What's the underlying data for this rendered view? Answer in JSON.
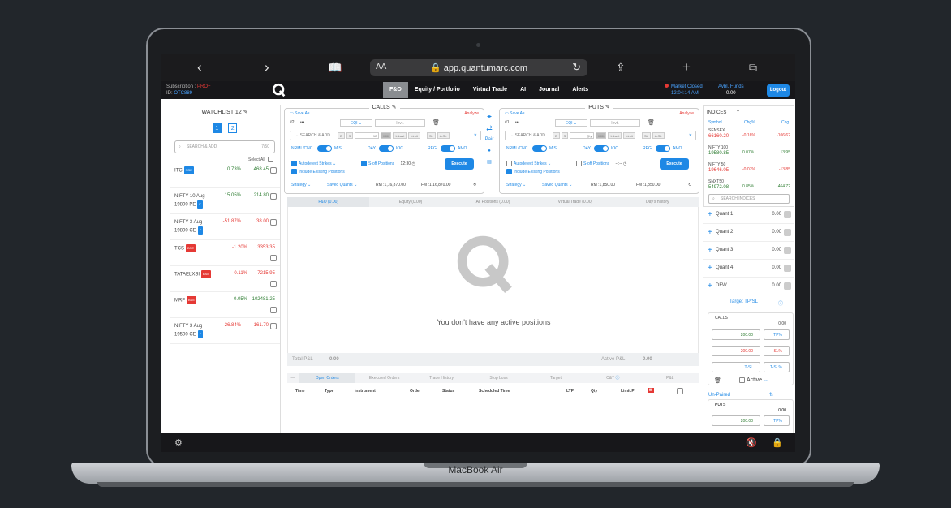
{
  "device": {
    "brand": "MacBook Air"
  },
  "browser": {
    "aa": "AA",
    "url": "app.quantumarc.com"
  },
  "header": {
    "subscription_label": "Subscription : ",
    "subscription_value": "PRO+",
    "id_label": "ID: ",
    "id_value": "OTC889",
    "nav": [
      "F&O",
      "Equity / Portfolio",
      "Virtual Trade",
      "AI",
      "Journal",
      "Alerts"
    ],
    "market_status": "Market Closed",
    "time": "12:04:14 AM",
    "funds_label": "Avbl. Funds",
    "funds_value": "0.00",
    "logout": "Logout"
  },
  "watchlist": {
    "title": "WATCHLIST 12",
    "tabs": [
      "1",
      "2"
    ],
    "search_placeholder": "SEARCH & ADD",
    "search_count": "7/50",
    "select_all": "Select All",
    "rows": [
      {
        "name1": "ITC",
        "name2": "",
        "tag": "NSE",
        "pct": "0.73%",
        "val": "468.45",
        "pos": true
      },
      {
        "name1": "NIFTY 10 Aug",
        "name2": "19800 PE",
        "tag": "F",
        "pct": "15.05%",
        "val": "214.80",
        "pos": true
      },
      {
        "name1": "NIFTY 3 Aug",
        "name2": "19800 CE",
        "tag": "F",
        "pct": "-51.87%",
        "val": "38.00",
        "pos": false
      },
      {
        "name1": "TCS",
        "name2": "",
        "tag": "BSE",
        "pct": "-1.20%",
        "val": "3353.35",
        "pos": false
      },
      {
        "name1": "TATAELXSI",
        "name2": "",
        "tag": "BSE",
        "pct": "-0.11%",
        "val": "7215.95",
        "pos": false
      },
      {
        "name1": "MRF",
        "name2": "",
        "tag": "BSE",
        "pct": "0.05%",
        "val": "102481.25",
        "pos": true
      },
      {
        "name1": "NIFTY 3 Aug",
        "name2": "19500 CE",
        "tag": "F",
        "pct": "-26.84%",
        "val": "161.70",
        "pos": false
      }
    ]
  },
  "calls": {
    "title": "CALLS",
    "save_as": "Save As",
    "analyze": "Analyze",
    "num": "#2",
    "more": "•••",
    "eq": "EQI",
    "invt": "Invt.",
    "search": "SEARCH & ADD",
    "chips": [
      "B",
      "S",
      "12",
      "MKt",
      "L.Last",
      "Limit",
      "SL",
      "A-SL"
    ],
    "nrml": "NRML/CNC",
    "mis": "MIS",
    "day": "DAY",
    "ioc": "IOC",
    "reg": "REG",
    "amo": "AMO",
    "autodetect": "Autodetect Strikes",
    "soff": "S-off Positions",
    "time": "12:30",
    "include": "Include Existing Positions",
    "execute": "Execute",
    "strategy": "Strategy",
    "saved": "Saved Quants",
    "rm": "RM :1,16,870.00",
    "fm": "FM :1,16,870.00"
  },
  "puts": {
    "title": "PUTS",
    "save_as": "Save As",
    "analyze": "Analyze",
    "num": "#1",
    "more": "•••",
    "eq": "EQI",
    "invt": "Invt.",
    "search": "SEARCH & ADD",
    "chips": [
      "B",
      "S",
      "Qty",
      "MKt",
      "L.Last",
      "Limit",
      "SL",
      "A-SL"
    ],
    "nrml": "NRML/CNC",
    "mis": "MIS",
    "day": "DAY",
    "ioc": "IOC",
    "reg": "REG",
    "amo": "AMO",
    "autodetect": "Autodetect Strikes",
    "soff": "S-off Positions",
    "time": "--:--",
    "include": "Include Existing Positions",
    "execute": "Execute",
    "strategy": "Strategy",
    "saved": "Saved Quants",
    "rm": "RM :1,850.00",
    "fm": "FM :1,850.00"
  },
  "middle": {
    "pair": "Pair"
  },
  "positions": {
    "tabs": [
      "F&O (0.00)",
      "Equity (0.00)",
      "All Positions (0.00)",
      "Virtual Trade (0.00)",
      "Day's history"
    ],
    "empty": "You don't have any active positions",
    "total_label": "Total P&L",
    "total_value": "0.00",
    "active_label": "Active P&L",
    "active_value": "0.00"
  },
  "orders": {
    "tabs": [
      "Open Orders",
      "Executed Orders",
      "Trade History",
      "Stop Loss",
      "Target",
      "C&T",
      "P&L"
    ],
    "columns": [
      "Time",
      "Type",
      "Instrument",
      "Order",
      "Status",
      "Scheduled Time",
      "LTP",
      "Qty",
      "Limit.P"
    ]
  },
  "indices": {
    "title": "INDICES",
    "cols": [
      "Symbol",
      "Chg%",
      "Chg"
    ],
    "rows": [
      {
        "sym": "SENSEX",
        "price": "66160.20",
        "pct": "-0.16%",
        "chg": "-106.62",
        "pos": false
      },
      {
        "sym": "NIFTY 100",
        "price": "19580.85",
        "pct": "0.07%",
        "chg": "13.95",
        "pos": true
      },
      {
        "sym": "NIFTY 50",
        "price": "19646.05",
        "pct": "-0.07%",
        "chg": "-13.85",
        "pos": false
      },
      {
        "sym": "SNXT50",
        "price": "54972.08",
        "pct": "0.85%",
        "chg": "464.72",
        "pos": true
      }
    ],
    "search": "SEARCH INDICES"
  },
  "quants": [
    {
      "name": "Quant 1",
      "val": "0.00"
    },
    {
      "name": "Quant 2",
      "val": "0.00"
    },
    {
      "name": "Quant 3",
      "val": "0.00"
    },
    {
      "name": "Quant 4",
      "val": "0.00"
    },
    {
      "name": "DFW",
      "val": "0.00"
    }
  ],
  "target": {
    "title": "Target TP/SL",
    "calls": "CALLS",
    "calls_val": "0.00",
    "v1": "200.00",
    "u1": "TP%",
    "v2": "-200.00",
    "u2": "SL%",
    "v3": "T-SL",
    "u3": "T-SL%",
    "active": "Active",
    "unpaired": "Un-Paired",
    "puts": "PUTS",
    "puts_val": "0.00",
    "pv1": "200.00",
    "pu1": "TP%"
  }
}
